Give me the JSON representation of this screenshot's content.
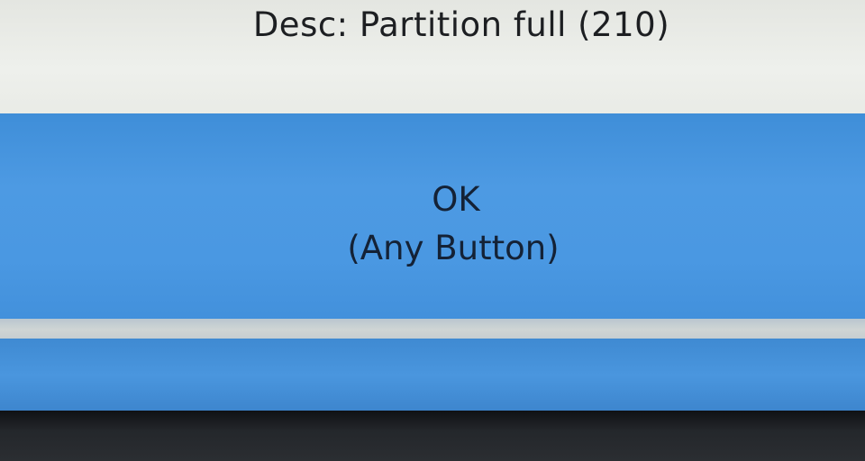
{
  "dialog": {
    "description": "Desc: Partition full (210)"
  },
  "ok_button": {
    "label": "OK",
    "hint": "(Any Button)"
  },
  "colors": {
    "top_panel": "#e9ebe6",
    "ok_panel": "#4a98e2",
    "divider": "#c8d0d2",
    "bottom_bar": "#4590d8",
    "bezel": "#1a1c1f",
    "text": "#1d1f22"
  }
}
